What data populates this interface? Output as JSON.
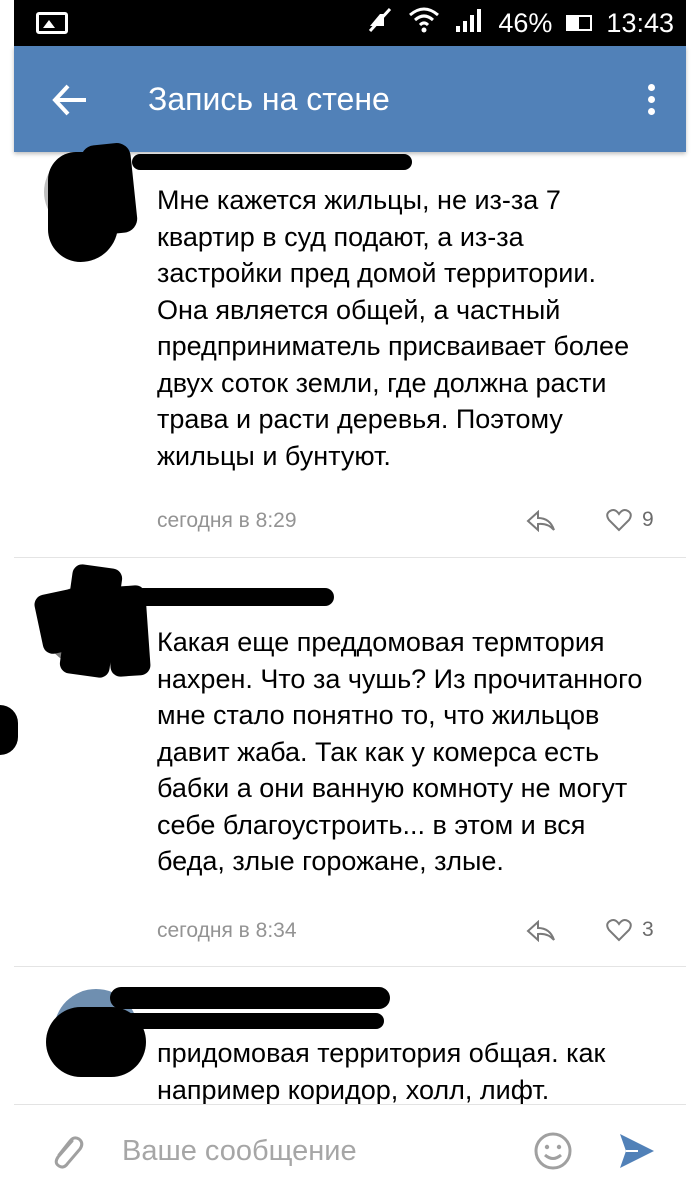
{
  "status_bar": {
    "battery": "46%",
    "time": "13:43",
    "icons": [
      "image-icon",
      "no-sound-icon",
      "wifi-icon",
      "signal-icon",
      "battery-icon"
    ]
  },
  "app_bar": {
    "title": "Запись на стене",
    "icons": [
      "back-arrow-icon",
      "more-vert-icon"
    ],
    "color": "#5181b8"
  },
  "comments": [
    {
      "text": "Мне кажется жильцы, не из-за 7 квартир в суд подают, а из-за застройки пред домой территории. Она является общей, а частный предприниматель присваивает более двух соток земли, где должна расти трава и расти деревья. Поэтому жильцы и бунтуют.",
      "time": "сегодня в 8:29",
      "likes": "9"
    },
    {
      "text": "Какая еще преддомовая термтория нахрен. Что за чушь? Из прочитанного мне стало понятно то, что жильцов давит жаба. Так как у комерса есть бабки а они ванную комноту не могут себе благоустроить... в этом и вся беда, злые горожане, злые.",
      "time": "сегодня в 8:34",
      "likes": "3"
    },
    {
      "text": "придомовая территория общая. как например коридор, холл, лифт."
    }
  ],
  "input_bar": {
    "placeholder": "Ваше сообщение",
    "icons": [
      "attach-icon",
      "emoji-icon",
      "send-icon"
    ]
  }
}
